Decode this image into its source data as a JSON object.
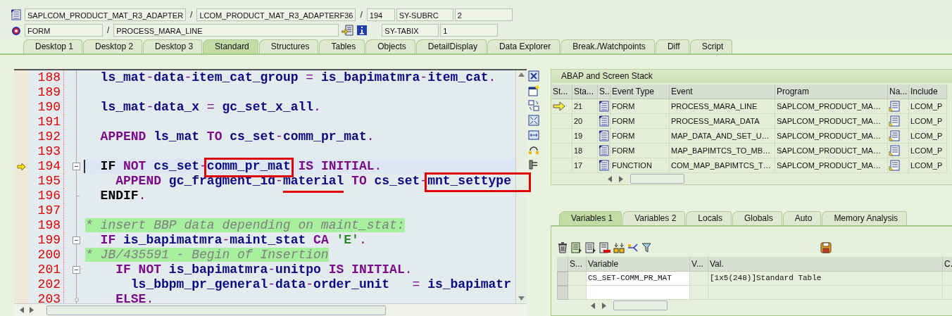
{
  "header": {
    "rows": [
      {
        "fields": [
          {
            "kind": "field",
            "text": "SAPLCOM_PRODUCT_MAT_R3_ADAPTER"
          },
          {
            "kind": "separator",
            "text": "/"
          },
          {
            "kind": "field",
            "text": "LCOM_PRODUCT_MAT_R3_ADAPTERF36"
          },
          {
            "kind": "separator",
            "text": "/"
          },
          {
            "kind": "field",
            "text": "194"
          },
          {
            "kind": "field",
            "text": "SY-SUBRC"
          },
          {
            "kind": "field",
            "text": "2"
          }
        ]
      },
      {
        "fields": [
          {
            "kind": "field",
            "text": "FORM"
          },
          {
            "kind": "separator",
            "text": "/"
          },
          {
            "kind": "field",
            "text": "PROCESS_MARA_LINE"
          },
          {
            "kind": "buttons"
          },
          {
            "kind": "field",
            "text": "SY-TABIX"
          },
          {
            "kind": "field",
            "text": "1"
          }
        ]
      }
    ]
  },
  "tabs": [
    {
      "label": "Desktop 1",
      "selected": false
    },
    {
      "label": "Desktop 2",
      "selected": false
    },
    {
      "label": "Desktop 3",
      "selected": false
    },
    {
      "label": "Standard",
      "selected": true
    },
    {
      "label": "Structures",
      "selected": false
    },
    {
      "label": "Tables",
      "selected": false
    },
    {
      "label": "Objects",
      "selected": false
    },
    {
      "label": "DetailDisplay",
      "selected": false
    },
    {
      "label": "Data Explorer",
      "selected": false
    },
    {
      "label": "Break./Watchpoints",
      "selected": false
    },
    {
      "label": "Diff",
      "selected": false
    },
    {
      "label": "Script",
      "selected": false
    }
  ],
  "editor": {
    "lines": [
      {
        "number": "188",
        "current": false,
        "kind": "plain",
        "tokens": [
          {
            "kind": "id",
            "text": "  ls_mat"
          },
          {
            "kind": "op",
            "text": "-"
          },
          {
            "kind": "id",
            "text": "data"
          },
          {
            "kind": "op",
            "text": "-"
          },
          {
            "kind": "id",
            "text": "item_cat_group"
          },
          {
            "kind": "op",
            "text": " = "
          },
          {
            "kind": "id",
            "text": "is_bapimatmra"
          },
          {
            "kind": "op",
            "text": "-"
          },
          {
            "kind": "id",
            "text": "item_cat"
          },
          {
            "kind": "op",
            "text": "."
          }
        ]
      },
      {
        "number": "189",
        "current": false,
        "kind": "plain"
      },
      {
        "number": "190",
        "current": false,
        "kind": "plain",
        "tokens": [
          {
            "kind": "id",
            "text": "  ls_mat"
          },
          {
            "kind": "op",
            "text": "-"
          },
          {
            "kind": "id",
            "text": "data_x"
          },
          {
            "kind": "op",
            "text": " = "
          },
          {
            "kind": "id",
            "text": "gc_set_x_all"
          },
          {
            "kind": "op",
            "text": "."
          }
        ]
      },
      {
        "number": "191",
        "current": false,
        "kind": "plain"
      },
      {
        "number": "192",
        "current": false,
        "kind": "plain",
        "tokens": [
          {
            "kind": "kw",
            "text": "  APPEND "
          },
          {
            "kind": "id",
            "text": "ls_mat "
          },
          {
            "kind": "kw",
            "text": "TO "
          },
          {
            "kind": "id",
            "text": "cs_set"
          },
          {
            "kind": "op",
            "text": "-"
          },
          {
            "kind": "id",
            "text": "comm_pr_mat"
          },
          {
            "kind": "op",
            "text": "."
          }
        ]
      },
      {
        "number": "193",
        "current": false,
        "kind": "plain"
      },
      {
        "number": "194",
        "current": true,
        "kind": "fold_start",
        "tokens": [
          {
            "kind": "plain",
            "text": "  IF "
          },
          {
            "kind": "kw",
            "text": "NOT "
          },
          {
            "kind": "id",
            "text": "cs_set"
          },
          {
            "kind": "op",
            "text": "-"
          },
          {
            "kind": "id",
            "text": "comm_pr_mat",
            "boxed": true
          },
          {
            "kind": "kw",
            "text": " IS INITIAL"
          },
          {
            "kind": "op",
            "text": "."
          }
        ]
      },
      {
        "number": "195",
        "current": false,
        "kind": "plain",
        "tokens": [
          {
            "kind": "kw",
            "text": "    APPEND "
          },
          {
            "kind": "id",
            "text": "gc_fragment_id"
          },
          {
            "kind": "op",
            "text": "-"
          },
          {
            "kind": "id",
            "text": "material",
            "underlined": true
          },
          {
            "kind": "kw",
            "text": " TO "
          },
          {
            "kind": "id",
            "text": "cs_set"
          },
          {
            "kind": "op",
            "text": "-"
          },
          {
            "kind": "id",
            "text": "mnt_settype",
            "boxed": true
          }
        ]
      },
      {
        "number": "196",
        "current": false,
        "kind": "fold_end",
        "tokens": [
          {
            "kind": "plain",
            "text": "  ENDIF"
          },
          {
            "kind": "op",
            "text": "."
          }
        ]
      },
      {
        "number": "197",
        "current": false,
        "kind": "plain"
      },
      {
        "number": "198",
        "current": false,
        "kind": "plain",
        "tokens": [
          {
            "kind": "comment",
            "text": "* insert BBP data depending on maint_stat:"
          }
        ]
      },
      {
        "number": "199",
        "current": false,
        "kind": "fold_start",
        "tokens": [
          {
            "kind": "kw",
            "text": "  IF "
          },
          {
            "kind": "id",
            "text": "is_bapimatmra"
          },
          {
            "kind": "op",
            "text": "-"
          },
          {
            "kind": "id",
            "text": "maint_stat "
          },
          {
            "kind": "kw",
            "text": "CA "
          },
          {
            "kind": "str",
            "text": "'E'"
          },
          {
            "kind": "op",
            "text": "."
          }
        ]
      },
      {
        "number": "200",
        "current": false,
        "kind": "plain",
        "tokens": [
          {
            "kind": "comment",
            "text": "* JB/435591 - Begin of Insertion"
          }
        ]
      },
      {
        "number": "201",
        "current": false,
        "kind": "fold_start",
        "tokens": [
          {
            "kind": "kw",
            "text": "    IF NOT "
          },
          {
            "kind": "id",
            "text": "is_bapimatmra"
          },
          {
            "kind": "op",
            "text": "-"
          },
          {
            "kind": "id",
            "text": "unitpo "
          },
          {
            "kind": "kw",
            "text": "IS INITIAL"
          },
          {
            "kind": "op",
            "text": "."
          }
        ]
      },
      {
        "number": "202",
        "current": false,
        "kind": "plain",
        "tokens": [
          {
            "kind": "id",
            "text": "      ls_bbpm_pr_general"
          },
          {
            "kind": "op",
            "text": "-"
          },
          {
            "kind": "id",
            "text": "data"
          },
          {
            "kind": "op",
            "text": "-"
          },
          {
            "kind": "id",
            "text": "order_unit"
          },
          {
            "kind": "op",
            "text": "   = "
          },
          {
            "kind": "id",
            "text": "is_bapimatr"
          }
        ]
      },
      {
        "number": "203",
        "current": false,
        "kind": "fold_branch",
        "tokens": [
          {
            "kind": "kw",
            "text": "    ELSE"
          },
          {
            "kind": "op",
            "text": "."
          }
        ]
      }
    ]
  },
  "stack": {
    "title": "ABAP and Screen Stack",
    "columns": [
      "St...",
      "Sta...",
      "S..",
      "Event Type",
      "Event",
      "Program",
      "Na...",
      "Include"
    ],
    "rows": [
      {
        "current": true,
        "level": "21",
        "event_type": "FORM",
        "event": "PROCESS_MARA_LINE",
        "program": "SAPLCOM_PRODUCT_MA…",
        "include": "LCOM_P"
      },
      {
        "current": false,
        "level": "20",
        "event_type": "FORM",
        "event": "PROCESS_MARA_DATA",
        "program": "SAPLCOM_PRODUCT_MA…",
        "include": "LCOM_P"
      },
      {
        "current": false,
        "level": "19",
        "event_type": "FORM",
        "event": "MAP_DATA_AND_SET_U…",
        "program": "SAPLCOM_PRODUCT_MA…",
        "include": "LCOM_P"
      },
      {
        "current": false,
        "level": "18",
        "event_type": "FORM",
        "event": "MAP_BAPIMTCS_TO_MB…",
        "program": "SAPLCOM_PRODUCT_MA…",
        "include": "LCOM_P"
      },
      {
        "current": false,
        "level": "17",
        "event_type": "FUNCTION",
        "event": "COM_MAP_BAPIMTCS_T…",
        "program": "SAPLCOM_PRODUCT_MA…",
        "include": "LCOM_P"
      }
    ]
  },
  "variables": {
    "tabs": [
      {
        "label": "Variables 1",
        "selected": true
      },
      {
        "label": "Variables 2",
        "selected": false
      },
      {
        "label": "Locals",
        "selected": false
      },
      {
        "label": "Globals",
        "selected": false
      },
      {
        "label": "Auto",
        "selected": false
      },
      {
        "label": "Memory Analysis",
        "selected": false
      }
    ],
    "columns": [
      "S...",
      "Variable",
      "V...",
      "Val.",
      "C."
    ],
    "rows": [
      {
        "variable": "CS_SET-COMM_PR_MAT",
        "value": "[1x5(248)]Standard Table"
      }
    ]
  }
}
